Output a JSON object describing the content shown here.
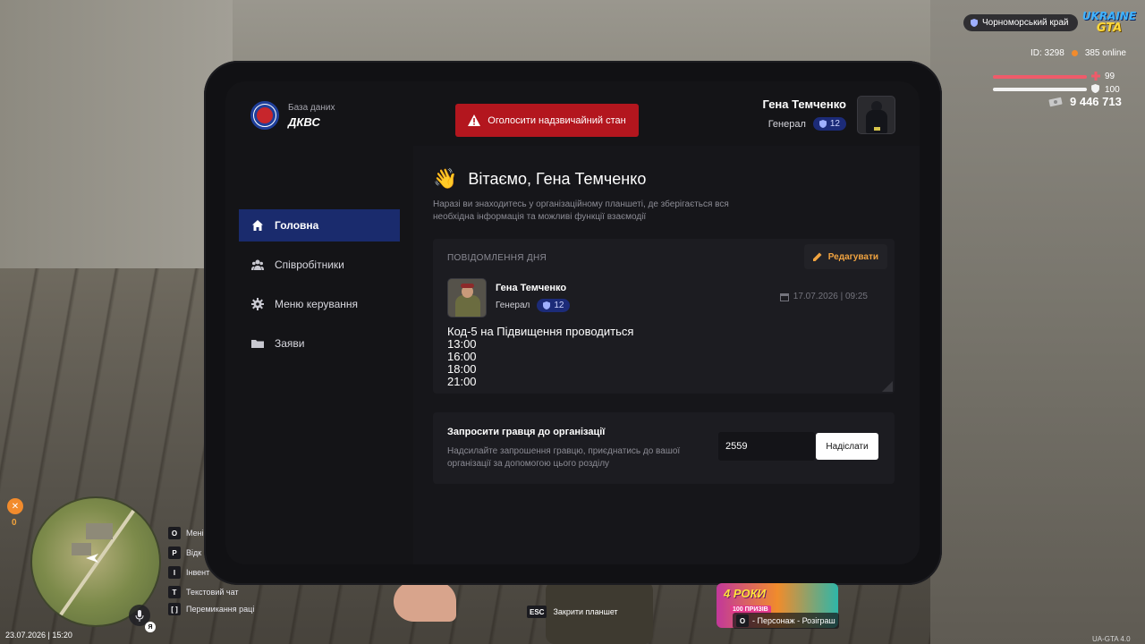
{
  "tablet": {
    "db_label": "База даних",
    "db_name": "ДКВС",
    "emergency_button": "Оголосити надзвичайний стан",
    "user": {
      "name": "Гена Темченко",
      "rank": "Генерал",
      "rank_level": "12"
    }
  },
  "sidebar": {
    "items": [
      {
        "label": "Головна",
        "icon": "home-icon",
        "active": true
      },
      {
        "label": "Співробітники",
        "icon": "users-icon",
        "active": false
      },
      {
        "label": "Меню керування",
        "icon": "gear-icon",
        "active": false
      },
      {
        "label": "Заяви",
        "icon": "folder-icon",
        "active": false
      }
    ]
  },
  "main": {
    "greeting": "Вітаємо, Гена Темченко",
    "intro": "Наразі ви знаходитесь у організаційному планшеті, де зберігається вся необхідна інформація та можливі функції взаємодії",
    "motd": {
      "title": "ПОВІДОМЛЕННЯ ДНЯ",
      "edit_label": "Редагувати",
      "author_name": "Гена Темченко",
      "author_rank": "Генерал",
      "author_rank_level": "12",
      "date": "17.07.2026 | 09:25",
      "text": "Код-5 на Підвищення проводиться\n13:00\n16:00\n18:00\n21:00"
    },
    "invite": {
      "title": "Запросити гравця до організації",
      "description": "Надсилайте запрошення гравцю, приєднатись до вашої організації за допомогою цього розділу",
      "input_value": "2559",
      "send_label": "Надіслати"
    }
  },
  "hud": {
    "region": "Чорноморський край",
    "logo_line1": "UKRAINE",
    "logo_line2": "GTA",
    "player_id": "ID: 3298",
    "online": "385 online",
    "health": 99,
    "armor": 100,
    "money": "9 446 713",
    "hunger": "0",
    "keybinds": [
      {
        "key": "O",
        "label": "Мені"
      },
      {
        "key": "P",
        "label": "Відк"
      },
      {
        "key": "I",
        "label": "Інвент"
      },
      {
        "key": "T",
        "label": "Текстовий чат"
      },
      {
        "key": "[ ]",
        "label": "Перемикання раці"
      }
    ],
    "mic_lang": "Я",
    "datetime": "23.07.2026 | 15:20",
    "esc_key": "ESC",
    "esc_label": "Закрити планшет",
    "promo_title": "4 РОКИ",
    "promo_sub": "100 ПРИЗІВ",
    "promo_key": "O",
    "promo_caption": "- Персонаж - Розіграш",
    "version": "UA-GTA 4.0"
  },
  "colors": {
    "accent_blue": "#1a2b6d",
    "emergency_red": "#b3161e",
    "edit_orange": "#f0a340",
    "health_red": "#ef5b6a"
  }
}
